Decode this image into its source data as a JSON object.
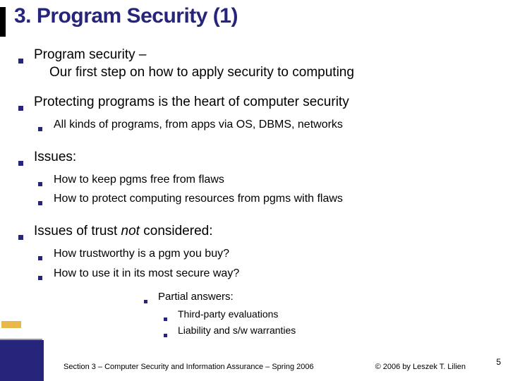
{
  "title": "3. Program Security (1)",
  "bullets": {
    "b0_line1": "Program security –",
    "b0_line2": "Our first step on how to apply security to computing",
    "b1": "Protecting programs is the heart of computer security",
    "b1_sub1": "All kinds of programs, from apps via OS, DBMS, networks",
    "b2": "Issues:",
    "b2_sub1": "How to keep pgms free from flaws",
    "b2_sub2": "How to protect computing resources from pgms with flaws",
    "b3_pre": "Issues of trust ",
    "b3_em": "not",
    "b3_post": " considered:",
    "b3_sub1": "How trustworthy is a pgm you buy?",
    "b3_sub2": "How to use it in its most secure way?",
    "partial": "Partial answers:",
    "partial_sub1": "Third-party evaluations",
    "partial_sub2": "Liability and  s/w warranties"
  },
  "footer": "Section 3 – Computer Security and Information Assurance – Spring 2006",
  "copyright": "© 2006 by Leszek T. Lilien",
  "pagenum": "5"
}
